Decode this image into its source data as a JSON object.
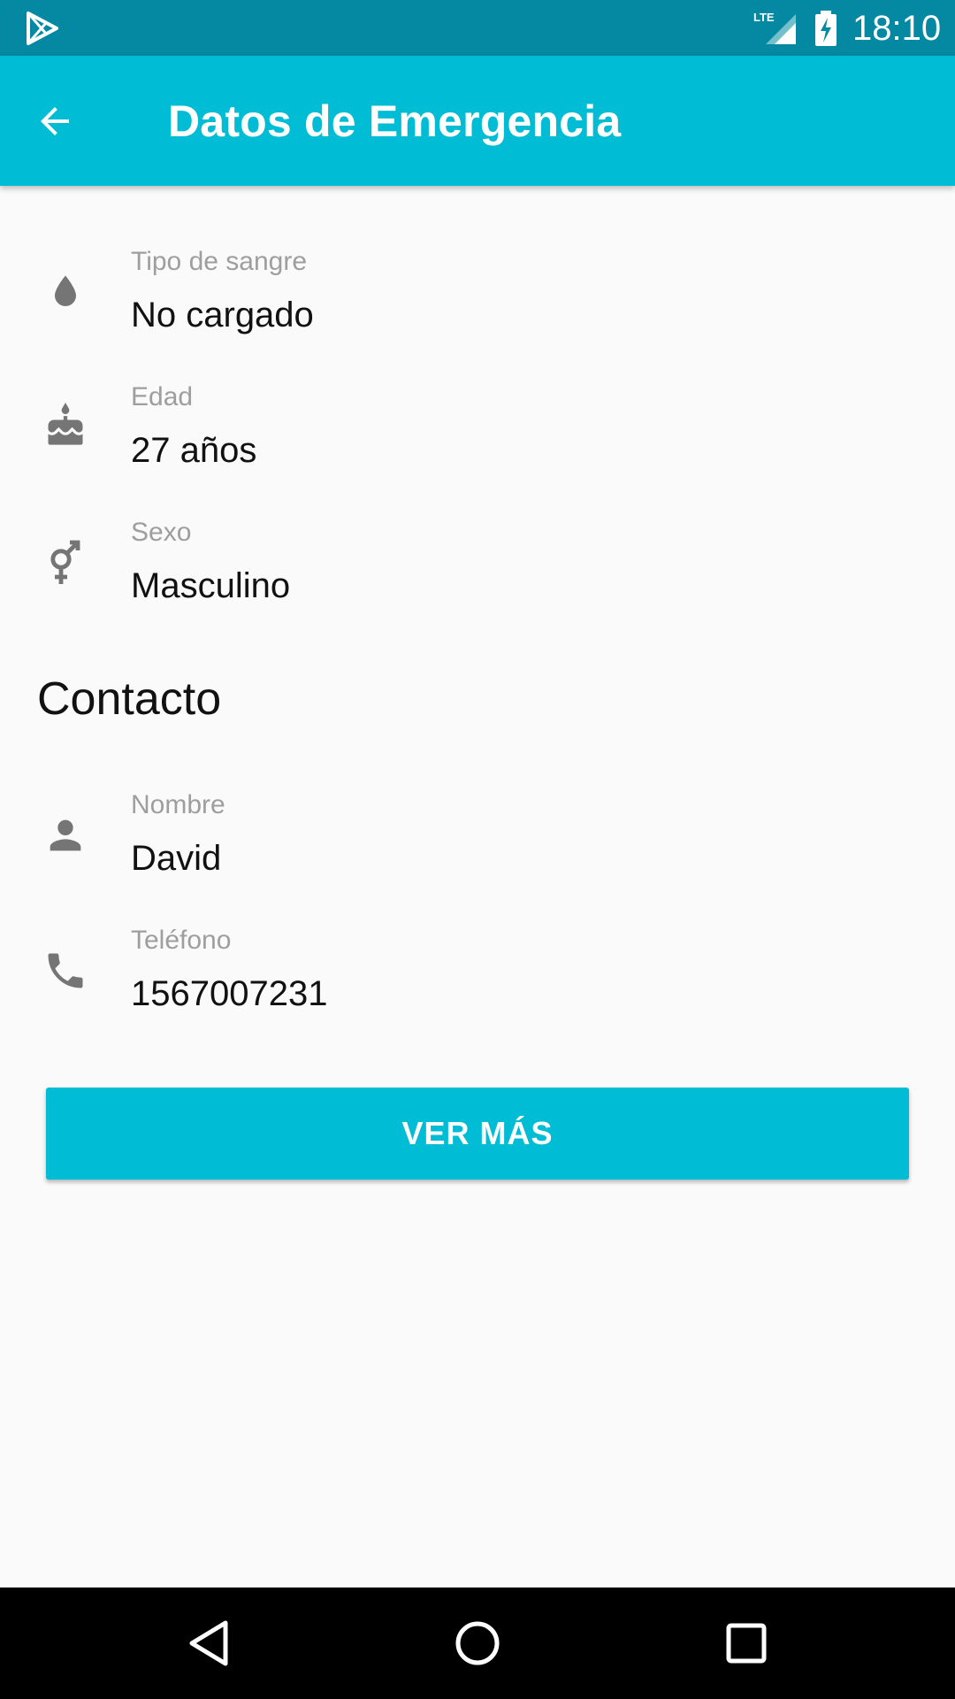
{
  "status_bar": {
    "time": "18:10",
    "icons": [
      "play-store-icon",
      "lte-signal-icon",
      "battery-charging-icon"
    ],
    "network_label": "LTE"
  },
  "app_bar": {
    "title": "Datos de Emergencia",
    "back_icon": "arrow-back-icon"
  },
  "personal": [
    {
      "icon": "blood-drop-icon",
      "label": "Tipo de sangre",
      "value": "No cargado"
    },
    {
      "icon": "cake-icon",
      "label": "Edad",
      "value": "27 años"
    },
    {
      "icon": "gender-icon",
      "label": "Sexo",
      "value": "Masculino"
    }
  ],
  "contact": {
    "heading": "Contacto",
    "items": [
      {
        "icon": "person-icon",
        "label": "Nombre",
        "value": "David"
      },
      {
        "icon": "phone-icon",
        "label": "Teléfono",
        "value": "1567007231"
      }
    ]
  },
  "button": {
    "label": "VER MÁS"
  },
  "nav_bar": {
    "icons": [
      "nav-back-icon",
      "nav-home-icon",
      "nav-recents-icon"
    ]
  },
  "colors": {
    "status_bar": "#0589a3",
    "primary": "#00bcd4",
    "background": "#fafafa",
    "icon_grey": "#757575",
    "label_grey": "#9e9e9e"
  }
}
